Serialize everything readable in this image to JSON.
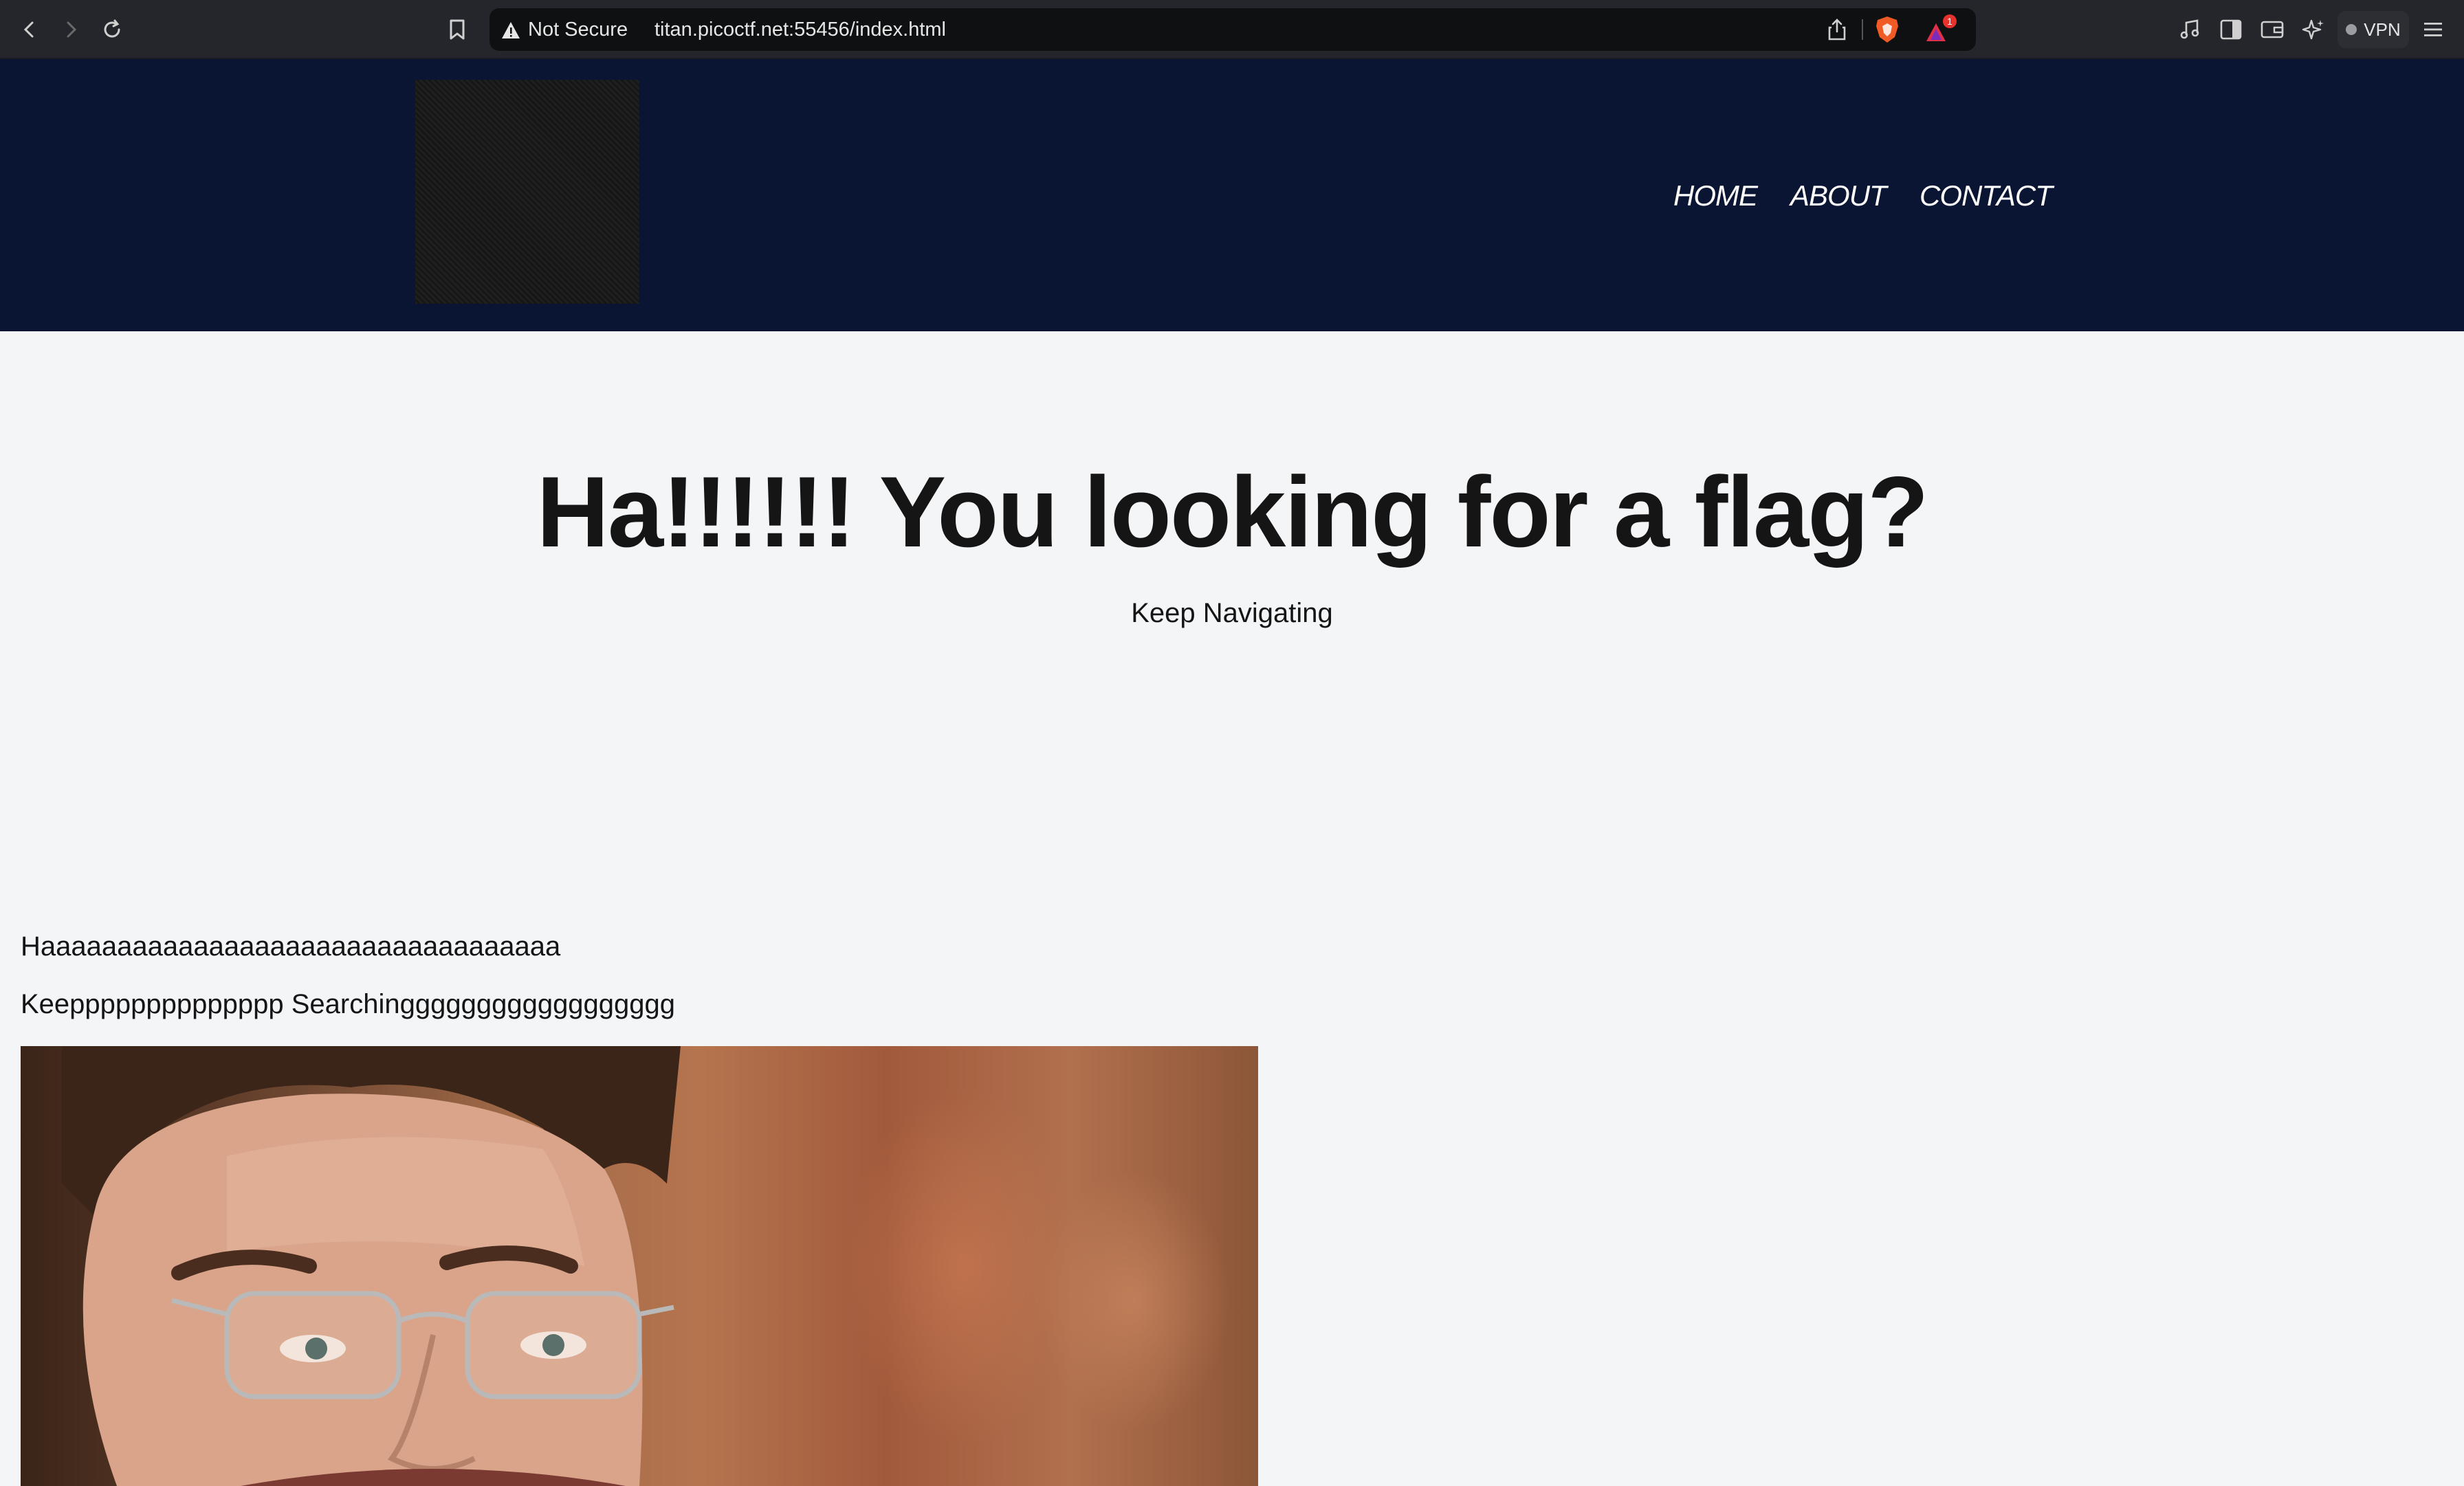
{
  "browser": {
    "security_label": "Not Secure",
    "url": "titan.picoctf.net:55456/index.html",
    "rewards_badge": "1",
    "vpn_label": "VPN",
    "icons": [
      "back-icon",
      "forward-icon",
      "reload-icon",
      "bookmark-icon",
      "warning-icon",
      "share-icon",
      "brave-shields-icon",
      "brave-rewards-icon",
      "media-icon",
      "sidebar-icon",
      "wallet-icon",
      "leo-ai-icon",
      "menu-icon"
    ]
  },
  "header": {
    "nav": [
      {
        "label": "HOME"
      },
      {
        "label": "ABOUT"
      },
      {
        "label": "CONTACT"
      }
    ],
    "colors": {
      "background": "#0a1433",
      "text": "#ffffff"
    }
  },
  "main": {
    "title": "Ha!!!!!! You looking for a flag?",
    "subtitle": "Keep Navigating",
    "line1": "Haaaaaaaaaaaaaaaaaaaaaaaaaaaaaaaaaa",
    "line2": "Keepppppppppppppp Searchingggggggggggggggggg"
  },
  "colors": {
    "page_background": "#f3f5f7",
    "text": "#151515"
  }
}
